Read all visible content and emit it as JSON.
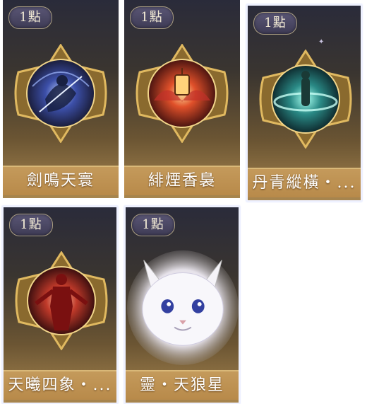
{
  "cards": [
    {
      "cost": "1點",
      "name": "劍鳴天寰",
      "selected": false,
      "icon": "sword-warrior-icon"
    },
    {
      "cost": "1點",
      "name": "緋煙香裊",
      "selected": false,
      "icon": "lantern-icon"
    },
    {
      "cost": "1點",
      "name": "丹青縱橫・...",
      "selected": true,
      "icon": "painting-warrior-icon"
    },
    {
      "cost": "1點",
      "name": "天曦四象・...",
      "selected": true,
      "icon": "red-figure-icon"
    },
    {
      "cost": "1點",
      "name": "靈・天狼星",
      "selected": true,
      "icon": "white-wolf-spirit-icon"
    }
  ]
}
